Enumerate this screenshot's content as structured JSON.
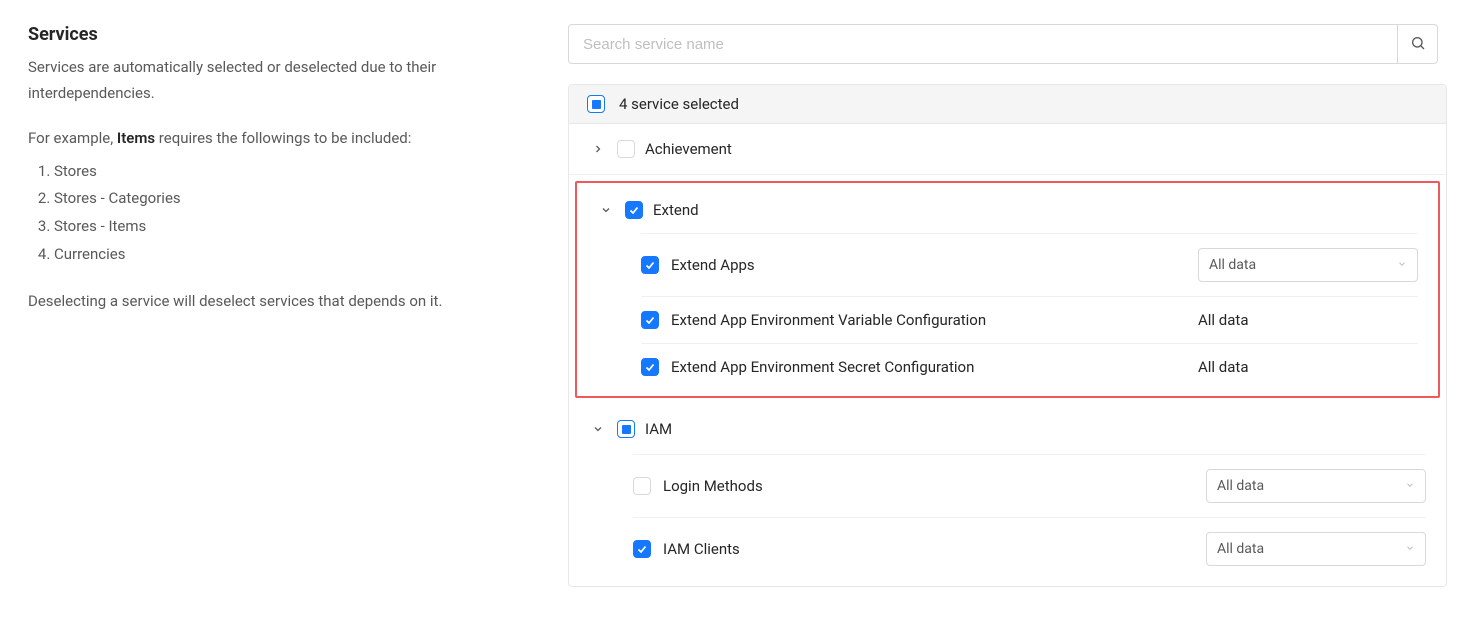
{
  "left": {
    "title": "Services",
    "description": "Services are automatically selected or deselected due to their interdependencies.",
    "example_lead_before": "For example, ",
    "example_lead_bold": "Items",
    "example_lead_after": " requires the followings to be included:",
    "example_items": [
      "Stores",
      "Stores - Categories",
      "Stores - Items",
      "Currencies"
    ],
    "deselect_note": "Deselecting a service will deselect services that depends on it."
  },
  "search": {
    "placeholder": "Search service name"
  },
  "panel": {
    "selected_text": "4 service selected",
    "groups": [
      {
        "id": "achievement",
        "label": "Achievement",
        "expanded": false,
        "state": "unchecked",
        "highlighted": false,
        "children": []
      },
      {
        "id": "extend",
        "label": "Extend",
        "expanded": true,
        "state": "checked",
        "highlighted": true,
        "children": [
          {
            "label": "Extend Apps",
            "state": "checked",
            "scope": "All data",
            "scope_as_select": true
          },
          {
            "label": "Extend App Environment Variable Configuration",
            "state": "checked",
            "scope": "All data",
            "scope_as_select": false
          },
          {
            "label": "Extend App Environment Secret Configuration",
            "state": "checked",
            "scope": "All data",
            "scope_as_select": false
          }
        ]
      },
      {
        "id": "iam",
        "label": "IAM",
        "expanded": true,
        "state": "indeterminate",
        "highlighted": false,
        "children": [
          {
            "label": "Login Methods",
            "state": "unchecked",
            "scope": "All data",
            "scope_as_select": true
          },
          {
            "label": "IAM Clients",
            "state": "checked",
            "scope": "All data",
            "scope_as_select": true
          }
        ]
      }
    ]
  }
}
